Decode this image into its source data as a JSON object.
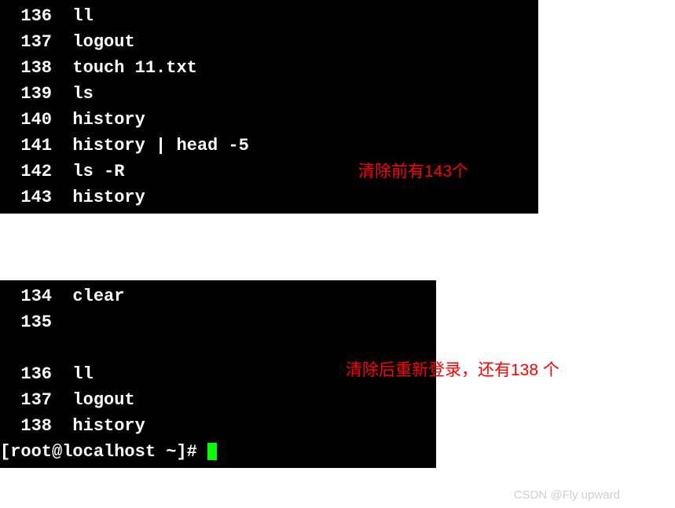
{
  "terminal1": {
    "lines": [
      {
        "num": "136",
        "cmd": "ll"
      },
      {
        "num": "137",
        "cmd": "logout"
      },
      {
        "num": "138",
        "cmd": "touch 11.txt"
      },
      {
        "num": "139",
        "cmd": "ls"
      },
      {
        "num": "140",
        "cmd": "history"
      },
      {
        "num": "141",
        "cmd": "history | head -5"
      },
      {
        "num": "142",
        "cmd": "ls -R"
      },
      {
        "num": "143",
        "cmd": "history"
      }
    ]
  },
  "terminal2": {
    "lines": [
      {
        "num": "134",
        "cmd": "clear"
      },
      {
        "num": "135",
        "cmd": ""
      },
      {
        "num": "",
        "cmd": ""
      },
      {
        "num": "136",
        "cmd": "ll"
      },
      {
        "num": "137",
        "cmd": "logout"
      },
      {
        "num": "138",
        "cmd": "history"
      }
    ],
    "prompt": "[root@localhost ~]# "
  },
  "annotations": {
    "a1": "清除前有143个",
    "a2": "清除后重新登录，还有138 个"
  },
  "watermark": "CSDN @Fly upward"
}
